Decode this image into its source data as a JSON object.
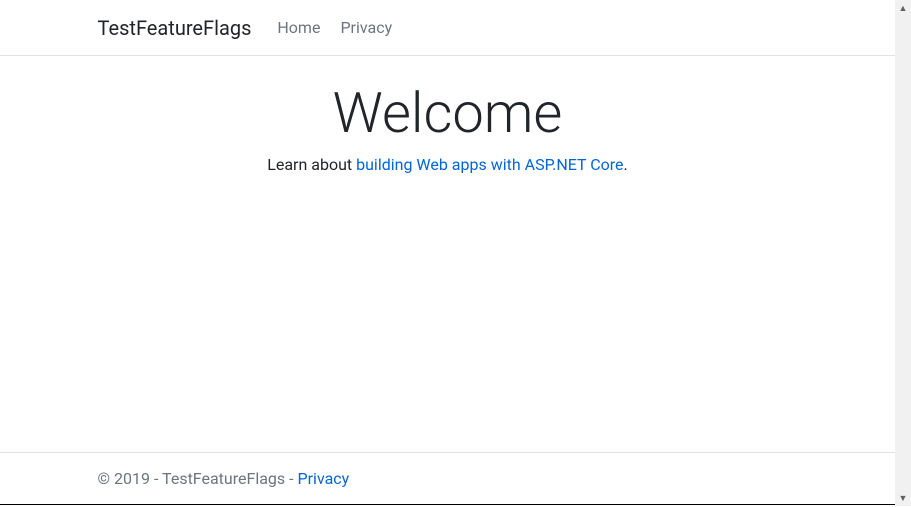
{
  "navbar": {
    "brand": "TestFeatureFlags",
    "links": [
      {
        "label": "Home"
      },
      {
        "label": "Privacy"
      }
    ]
  },
  "main": {
    "heading": "Welcome",
    "lead_prefix": "Learn about ",
    "lead_link": "building Web apps with ASP.NET Core",
    "lead_suffix": "."
  },
  "footer": {
    "copyright_prefix": "© 2019 - TestFeatureFlags - ",
    "privacy_link": "Privacy"
  }
}
